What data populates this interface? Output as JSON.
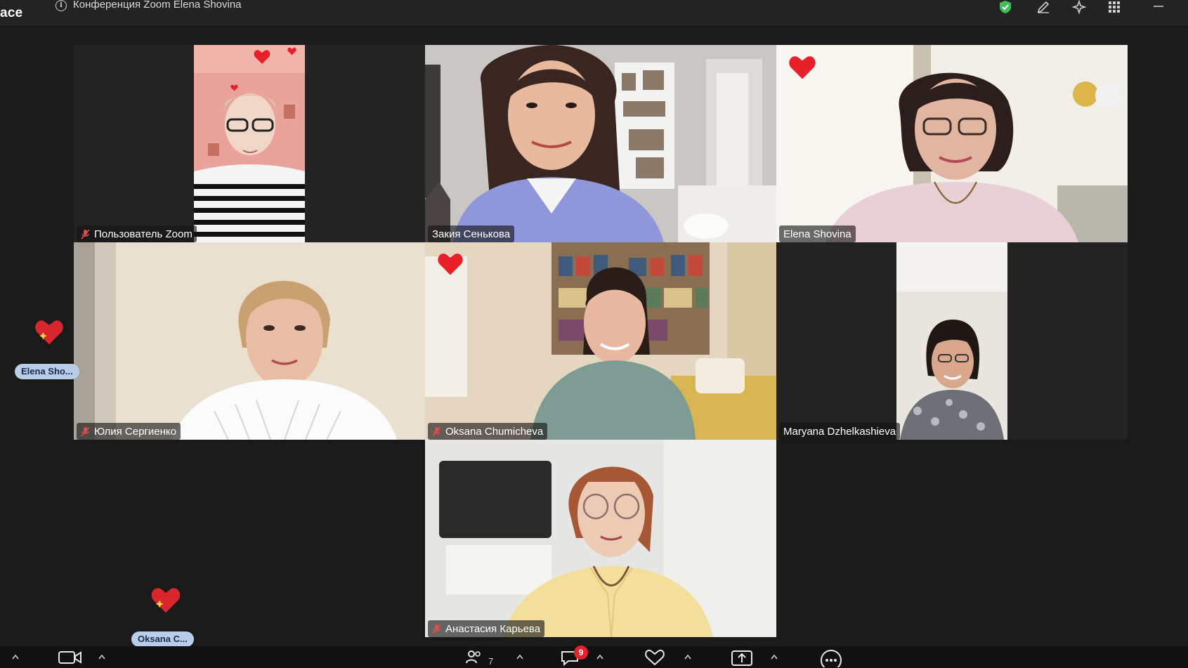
{
  "app": {
    "name": "ace"
  },
  "window": {
    "title": "Конференция Zoom Elena Shovina"
  },
  "participants": [
    {
      "name": "Пользователь Zoom",
      "muted": true
    },
    {
      "name": "Закия Сенькова",
      "muted": false,
      "active_speaker": true
    },
    {
      "name": "Elena Shovina",
      "muted": false
    },
    {
      "name": "Юлия Сергиенко",
      "muted": true
    },
    {
      "name": "Oksana Chumicheva",
      "muted": true
    },
    {
      "name": "Maryana Dzhelkashieva",
      "muted": false
    },
    {
      "name": "Анастасия Карьева",
      "muted": true
    }
  ],
  "reactions": [
    {
      "sender": "Elena Sho...",
      "icon": "heart-icon"
    },
    {
      "sender": "Oksana C...",
      "icon": "heart-icon"
    }
  ],
  "toolbar": {
    "participants_count": "7",
    "chat_badge": "9"
  },
  "colors": {
    "active_speaker_border": "#6fe38a",
    "heart": "#e8202a",
    "badge": "#e0242e",
    "reaction_label_bg": "#b9cce8",
    "encryption_shield": "#3fbf5a"
  }
}
